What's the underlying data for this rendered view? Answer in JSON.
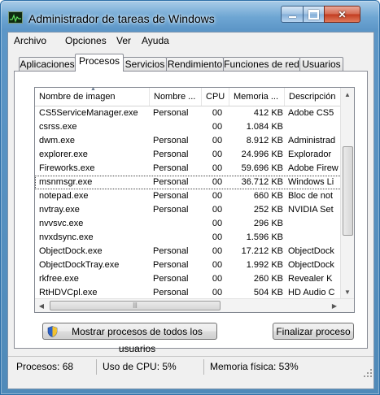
{
  "window": {
    "title": "Administrador de tareas de Windows"
  },
  "menu": [
    "Archivo",
    "Opciones",
    "Ver",
    "Ayuda"
  ],
  "tabs": [
    "Aplicaciones",
    "Procesos",
    "Servicios",
    "Rendimiento",
    "Funciones de red",
    "Usuarios"
  ],
  "active_tab": "Procesos",
  "columns": [
    "Nombre de imagen",
    "Nombre ...",
    "CPU",
    "Memoria ...",
    "Descripción"
  ],
  "rows": [
    [
      "CS5ServiceManager.exe",
      "Personal",
      "00",
      "412 KB",
      "Adobe CS5"
    ],
    [
      "csrss.exe",
      "",
      "00",
      "1.084 KB",
      ""
    ],
    [
      "dwm.exe",
      "Personal",
      "00",
      "8.912 KB",
      "Administrad"
    ],
    [
      "explorer.exe",
      "Personal",
      "00",
      "24.996 KB",
      "Explorador"
    ],
    [
      "Fireworks.exe",
      "Personal",
      "00",
      "59.696 KB",
      "Adobe Firew"
    ],
    [
      "msnmsgr.exe",
      "Personal",
      "00",
      "36.712 KB",
      "Windows Li"
    ],
    [
      "notepad.exe",
      "Personal",
      "00",
      "660 KB",
      "Bloc de not"
    ],
    [
      "nvtray.exe",
      "Personal",
      "00",
      "252 KB",
      "NVIDIA Set"
    ],
    [
      "nvvsvc.exe",
      "",
      "00",
      "296 KB",
      ""
    ],
    [
      "nvxdsync.exe",
      "",
      "00",
      "1.596 KB",
      ""
    ],
    [
      "ObjectDock.exe",
      "Personal",
      "00",
      "17.212 KB",
      "ObjectDock"
    ],
    [
      "ObjectDockTray.exe",
      "Personal",
      "00",
      "1.992 KB",
      "ObjectDock"
    ],
    [
      "rkfree.exe",
      "Personal",
      "00",
      "260 KB",
      "Revealer K"
    ],
    [
      "RtHDVCpl.exe",
      "Personal",
      "00",
      "504 KB",
      "HD Audio C"
    ]
  ],
  "selected_row": "msnmsgr.exe",
  "buttons": {
    "show_all": "Mostrar procesos de todos los usuarios",
    "end_process": "Finalizar proceso"
  },
  "status": {
    "processes": "Procesos: 68",
    "cpu": "Uso de CPU: 5%",
    "memory": "Memoria física: 53%"
  },
  "icons": [
    "app-icon",
    "minimize-icon",
    "maximize-icon",
    "close-icon",
    "sort-arrow-icon",
    "shield-icon",
    "resize-grip-icon"
  ]
}
